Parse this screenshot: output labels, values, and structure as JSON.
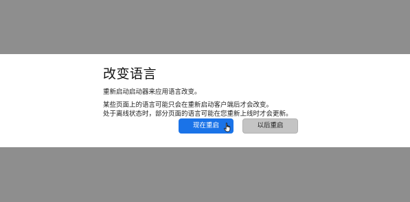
{
  "dialog": {
    "title": "改变语言",
    "subtitle": "重新启动启动器来应用语言改变。",
    "notes": [
      "某些页面上的语言可能只会在重新启动客户端后才会改变。",
      "处于离线状态时，部分页面的语言可能在您重新上线时才会更新。"
    ],
    "buttons": {
      "restart_now": "现在重启",
      "restart_later": "以后重启"
    }
  },
  "colors": {
    "overlay": "#8e8e8e",
    "dialog_background": "#ffffff",
    "primary_button": "#1a73e8",
    "secondary_button": "#c4c4c4"
  },
  "icons": {
    "cursor": "hand-pointer-icon"
  }
}
